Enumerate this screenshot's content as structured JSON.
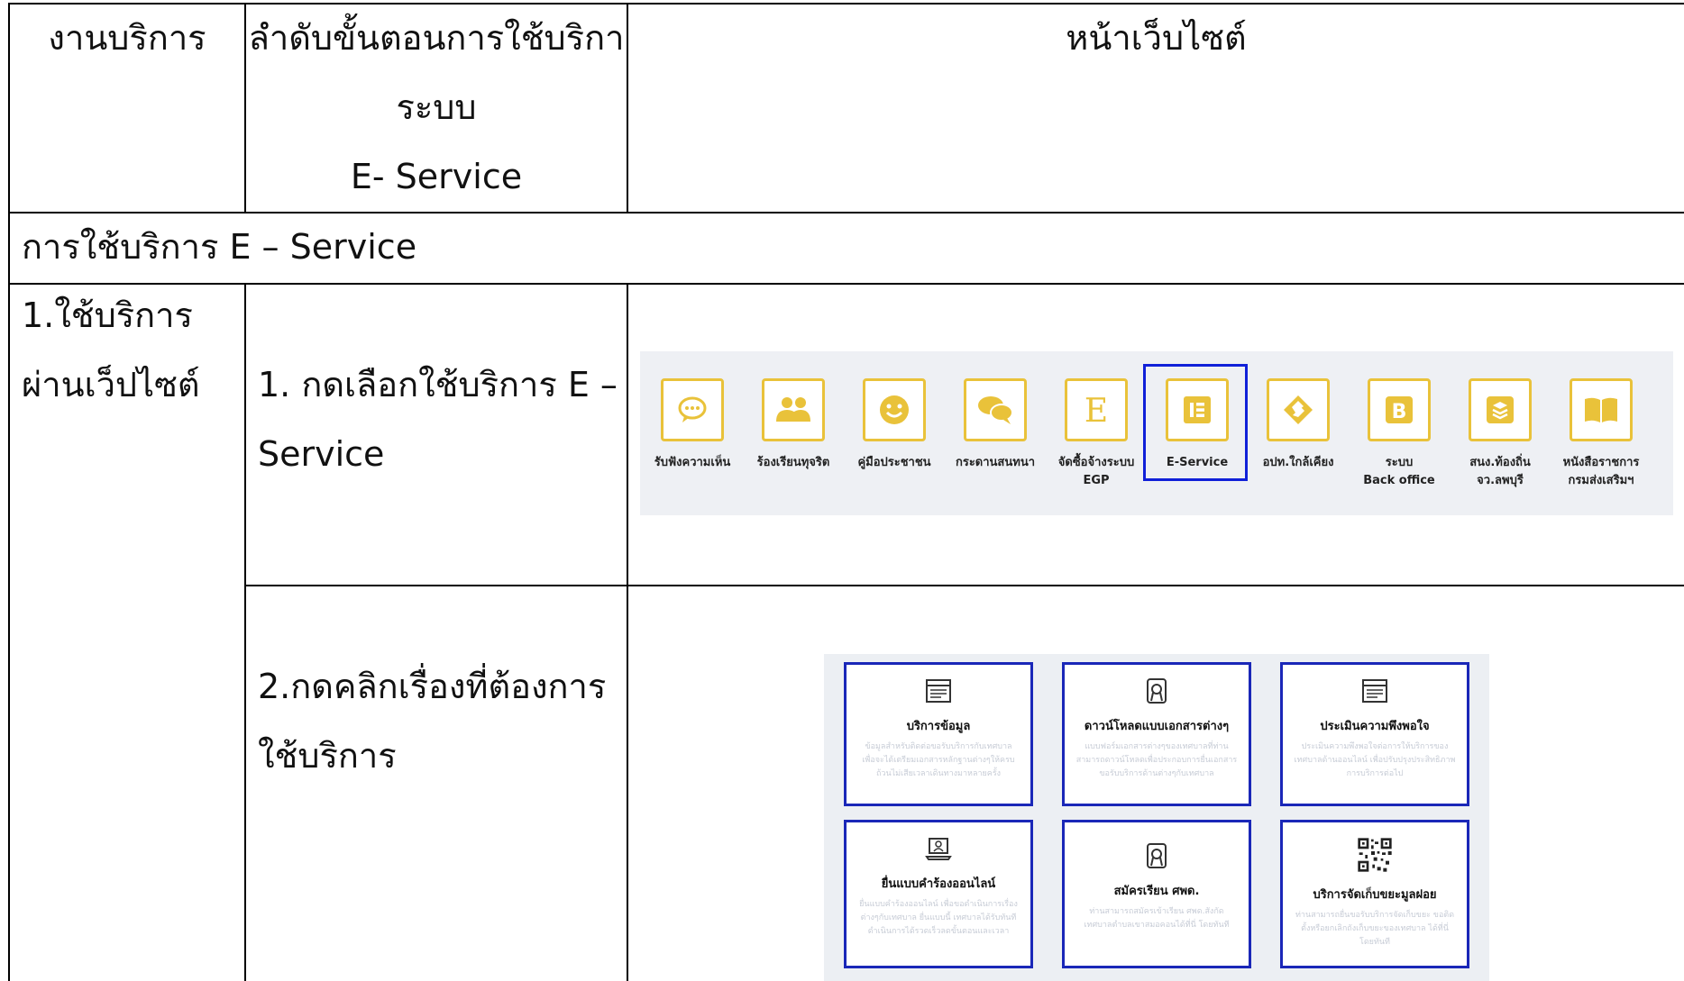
{
  "header": {
    "col1": "งานบริการ",
    "col2_line1": "ลำดับขั้นตอนการใช้บริกา",
    "col2_line2": "ระบบ",
    "col2_line3": "E- Service",
    "col3": "หน้าเว็บไซต์"
  },
  "section_title": "การใช้บริการ E – Service",
  "service": {
    "line1": "1.ใช้บริการ",
    "line2": "ผ่านเว็ปไซต์"
  },
  "steps": [
    {
      "line1": "1. กดเลือกใช้บริการ E –",
      "line2": "Service"
    },
    {
      "line1": "2.กดคลิกเรื่องที่ต้องการ",
      "line2": "ใช้บริการ"
    }
  ],
  "icon_bar": {
    "accent_color": "#e9c23a",
    "highlight_color": "#1020d8",
    "items": [
      {
        "label": "รับฟังความเห็น",
        "icon": "chat-bubble-icon"
      },
      {
        "label": "ร้องเรียนทุจริต",
        "icon": "users-icon"
      },
      {
        "label": "คู่มือประชาชน",
        "icon": "smiley-icon"
      },
      {
        "label": "กระดานสนทนา",
        "icon": "comments-icon"
      },
      {
        "label": "จัดซื้อจ้างระบบ\nEGP",
        "icon": "letter-e-icon"
      },
      {
        "label": "E-Service",
        "icon": "elementor-icon",
        "selected": true
      },
      {
        "label": "อปท.ใกล้เคียง",
        "icon": "diamond-icon"
      },
      {
        "label": "ระบบ\nBack office",
        "icon": "letter-b-icon"
      },
      {
        "label": "สนง.ท้องถิ่น\nจว.ลพบุรี",
        "icon": "layers-icon"
      },
      {
        "label": "หนังสือราชการ\nกรมส่งเสริมฯ",
        "icon": "book-icon"
      }
    ]
  },
  "service_cards": [
    {
      "title": "บริการข้อมูล",
      "icon": "browser-window-icon",
      "desc": "ข้อมูลสำหรับติดต่อขอรับบริการกับเทศบาล เพื่อจะได้เตรียมเอกสารหลักฐานต่างๆให้ครบถ้วนไม่เสียเวลาเดินทางมาหลายครั้ง"
    },
    {
      "title": "ดาวน์โหลดแบบเอกสารต่างๆ",
      "icon": "certificate-icon",
      "desc": "แบบฟอร์มเอกสารต่างๆของเทศบาลที่ท่านสามารถดาวน์โหลดเพื่อประกอบการยื่นเอกสารขอรับบริการด้านต่างๆกับเทศบาล"
    },
    {
      "title": "ประเมินความพึงพอใจ",
      "icon": "browser-window-icon",
      "desc": "ประเมินความพึงพอใจต่อการให้บริการของเทศบาลด้านออนไลน์ เพื่อปรับปรุงประสิทธิภาพการบริการต่อไป"
    },
    {
      "title": "ยื่นแบบคำร้องออนไลน์",
      "icon": "laptop-user-icon",
      "desc": "ยื่นแบบคำร้องออนไลน์ เพื่อขอดำเนินการเรื่องต่างๆกับเทศบาล ยื่นแบบนี้ เทศบาลได้รับทันที ดำเนินการได้รวดเร็วลดขั้นตอนและเวลา"
    },
    {
      "title": "สมัครเรียน ศพด.",
      "icon": "certificate-icon",
      "desc": "ท่านสามารถสมัครเข้าเรียน ศพด.สังกัดเทศบาลตำบลเขาสมอคอนได้ที่นี่ โดยทันที"
    },
    {
      "title": "บริการจัดเก็บขยะมูลฝอย",
      "icon": "qr-code-icon",
      "desc": "ท่านสามารถยื่นขอรับบริการจัดเก็บขยะ ขอติดตั้งหรือยกเลิกถังเก็บขยะของเทศบาล ได้ที่นี่ โดยทันที"
    }
  ]
}
